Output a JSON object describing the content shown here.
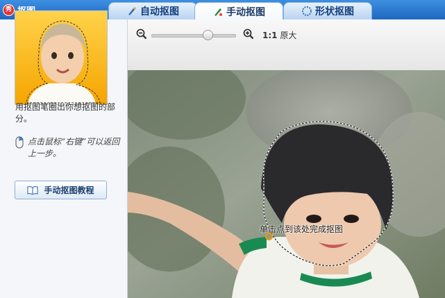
{
  "app": {
    "title": "抠图",
    "logo_char": "秀"
  },
  "tabs": [
    {
      "label": "自动抠图",
      "icon": "brush-icon",
      "active": false
    },
    {
      "label": "手动抠图",
      "icon": "pen-icon",
      "active": true
    },
    {
      "label": "形状抠图",
      "icon": "shape-icon",
      "active": false
    }
  ],
  "sidebar": {
    "help_text": "用抠图笔圈出你想抠图的部分。",
    "hint": "点击鼠标“右键”可以返回上一步。",
    "tutorial_button": "手动抠图教程"
  },
  "toolbar": {
    "ratio_value": "1:1",
    "ratio_label": "原大",
    "zoom_level": 0.67
  },
  "canvas": {
    "tip": "单击点到该处完成抠图"
  },
  "colors": {
    "accent": "#1e67c2",
    "cursor": "#f39a00"
  }
}
